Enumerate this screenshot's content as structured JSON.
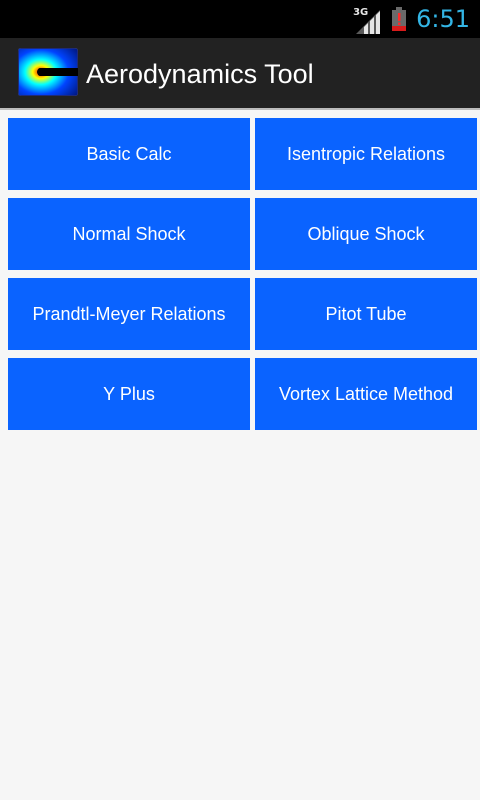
{
  "status_bar": {
    "network_label": "3G",
    "time": "6:51",
    "clock_color": "#33b5e5",
    "signal_icon": "signal-icon",
    "battery_icon": "battery-alert-icon"
  },
  "action_bar": {
    "title": "Aerodynamics Tool",
    "app_icon": "app-logo-icon"
  },
  "tiles": [
    {
      "label": "Basic Calc"
    },
    {
      "label": "Isentropic Relations"
    },
    {
      "label": "Normal Shock"
    },
    {
      "label": "Oblique Shock"
    },
    {
      "label": "Prandtl-Meyer Relations"
    },
    {
      "label": "Pitot Tube"
    },
    {
      "label": "Y Plus"
    },
    {
      "label": "Vortex Lattice Method"
    }
  ],
  "colors": {
    "tile_background": "#0a63ff",
    "background": "#f6f6f6",
    "action_bar": "#222222"
  }
}
